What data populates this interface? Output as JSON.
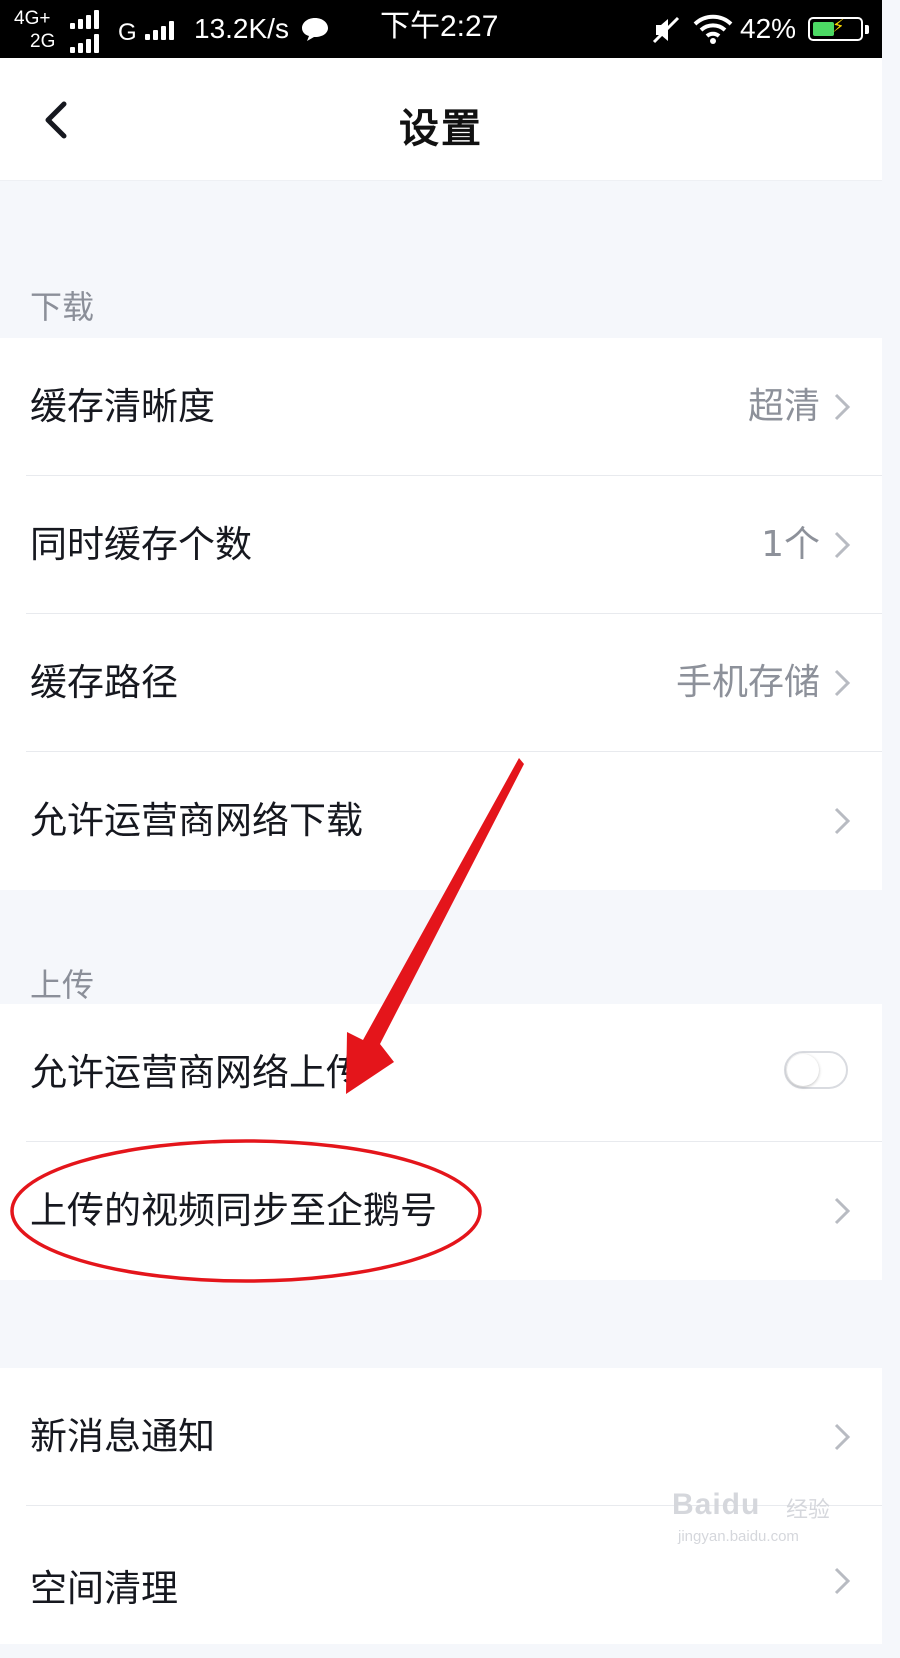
{
  "status_bar": {
    "network_top": "4G+",
    "network_bottom": "2G",
    "network_g": "G",
    "speed": "13.2K/s",
    "time": "下午2:27",
    "battery": "42%",
    "battery_level": 0.42,
    "icons": [
      "signal-icon",
      "chat-bubble-icon",
      "mute-icon",
      "wifi-icon",
      "battery-icon"
    ]
  },
  "header": {
    "title": "设置",
    "back_icon": "chevron-left-icon"
  },
  "sections": {
    "download": {
      "label": "下载",
      "rows": [
        {
          "label": "缓存清晰度",
          "value": "超清"
        },
        {
          "label": "同时缓存个数",
          "value": "1个"
        },
        {
          "label": "缓存路径",
          "value": "手机存储"
        },
        {
          "label": "允许运营商网络下载",
          "value": ""
        }
      ]
    },
    "upload": {
      "label": "上传",
      "rows": [
        {
          "label": "允许运营商网络上传",
          "toggle": false
        },
        {
          "label": "上传的视频同步至企鹅号",
          "value": ""
        }
      ]
    },
    "other": {
      "rows": [
        {
          "label": "新消息通知",
          "value": ""
        },
        {
          "label": "空间清理",
          "value": ""
        }
      ]
    }
  },
  "colors": {
    "background": "#f5f7fb",
    "row_background": "#ffffff",
    "section_label": "#8b8f99",
    "secondary_text": "#8d919a",
    "annotation_red": "#e4151b"
  },
  "watermark": {
    "brand": "Baidu",
    "sub": "经验",
    "url": "jingyan.baidu.com"
  }
}
